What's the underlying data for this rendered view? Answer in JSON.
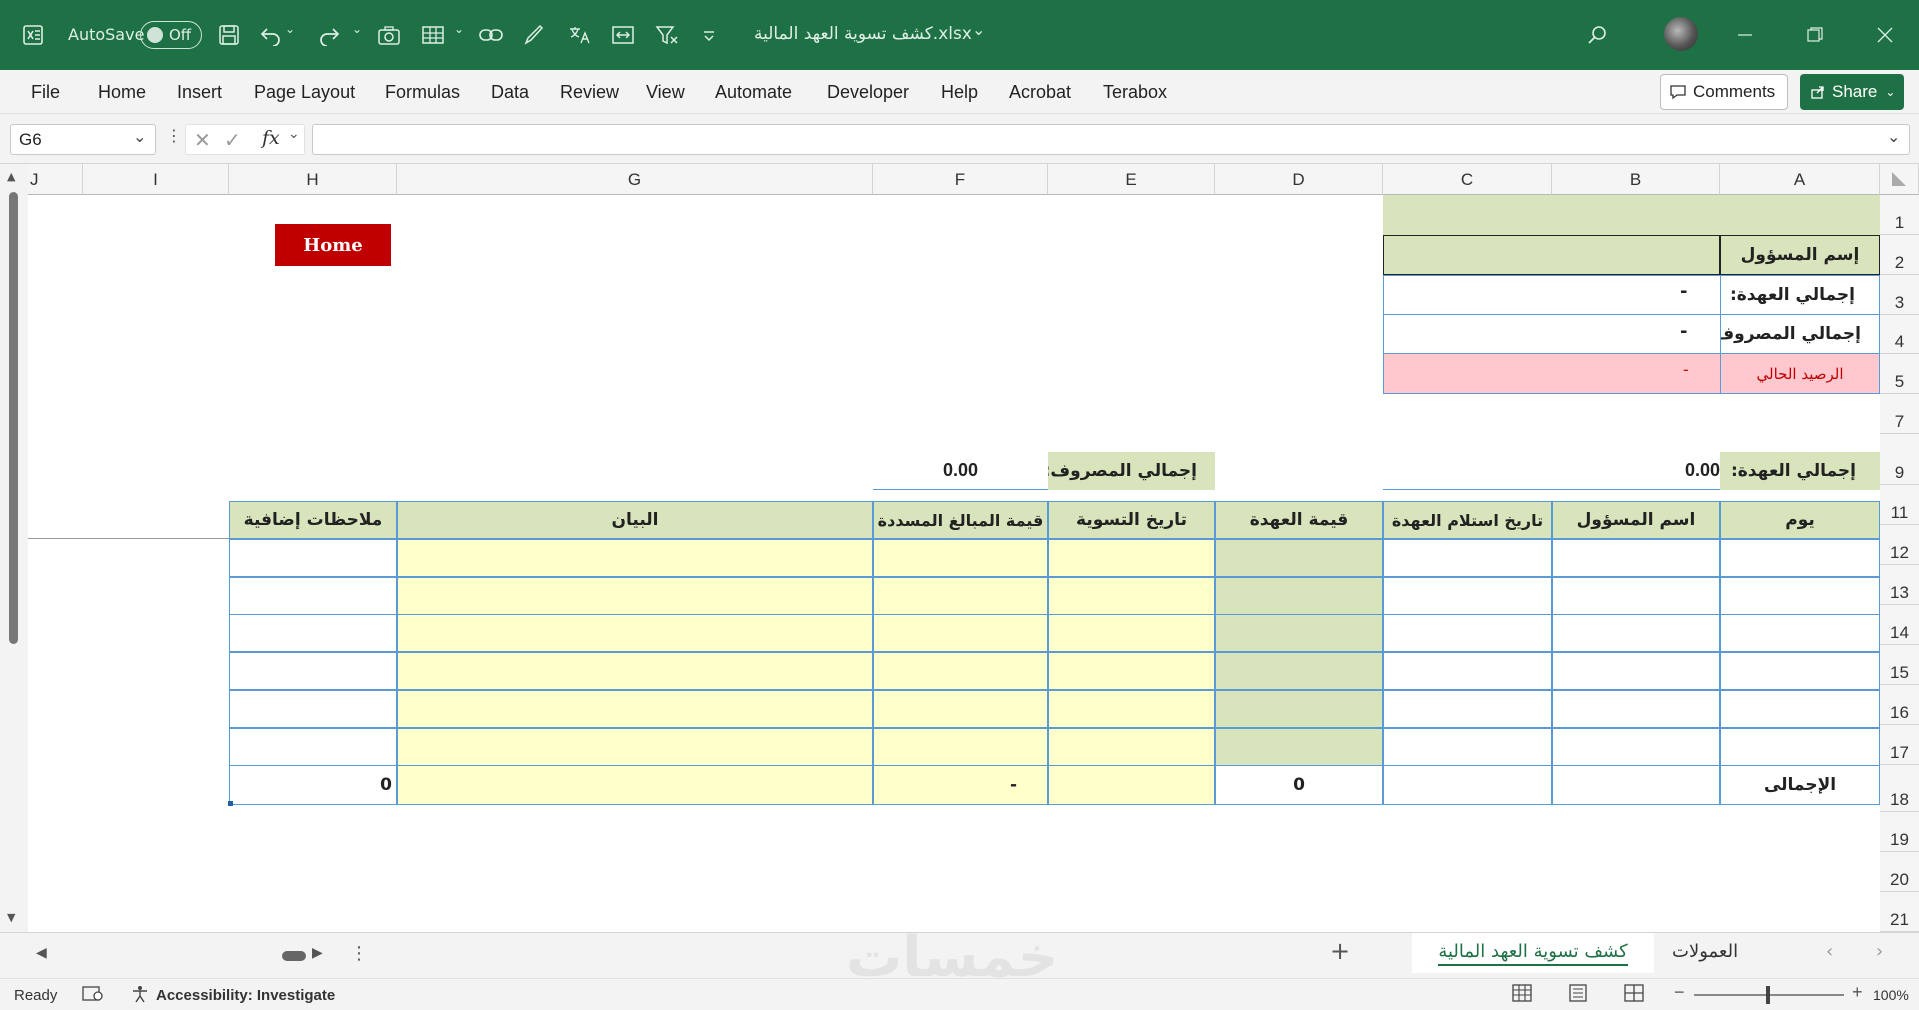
{
  "titlebar": {
    "autosave_label": "AutoSave",
    "autosave_state": "Off",
    "filename": "كشف تسوية العهد المالية.xlsx",
    "icons": [
      "excel-icon",
      "save-icon",
      "undo-icon",
      "redo-icon",
      "camera-icon",
      "table-icon",
      "link-icon",
      "brush-icon",
      "translate-icon",
      "compress-icon",
      "filter-clear-icon",
      "customize-icon",
      "search-icon",
      "avatar",
      "minimize-icon",
      "restore-icon",
      "close-icon"
    ]
  },
  "ribbon": {
    "tabs": [
      "File",
      "Home",
      "Insert",
      "Page Layout",
      "Formulas",
      "Data",
      "Review",
      "View",
      "Automate",
      "Developer",
      "Help",
      "Acrobat",
      "Terabox"
    ],
    "comments_label": "Comments",
    "share_label": "Share"
  },
  "formula_bar": {
    "name_box": "G6",
    "fx": "fx",
    "formula": ""
  },
  "columns": [
    "J",
    "I",
    "H",
    "G",
    "F",
    "E",
    "D",
    "C",
    "B",
    "A"
  ],
  "rows": [
    "1",
    "2",
    "3",
    "4",
    "5",
    "7",
    "9",
    "11",
    "12",
    "13",
    "14",
    "15",
    "16",
    "17",
    "18",
    "19",
    "20",
    "21"
  ],
  "sheet": {
    "home_button": "Home",
    "top_table": {
      "owner_label": "إسم المسؤول",
      "total_custody_label": "إجمالي العهدة:",
      "total_custody_value": "-",
      "total_spent_label": "إجمالي المصروف:",
      "total_spent_value": "-",
      "current_balance_label": "الرصيد الحالي",
      "current_balance_value": "-"
    },
    "summary": {
      "custody_label": "إجمالي العهدة:",
      "custody_value": "0.00",
      "spent_label": "إجمالي المصروف:",
      "spent_value": "0.00"
    },
    "main_table": {
      "headers": {
        "day": "يوم",
        "owner": "اسم المسؤول",
        "received_date": "تاريخ استلام العهدة",
        "custody_value": "قيمة العهدة",
        "settlement_date": "تاريخ التسوية",
        "paid_amount": "قيمة المبالغ المسددة",
        "statement": "البيان",
        "notes": "ملاحظات إضافية"
      },
      "total_label": "الإجمالى",
      "total_custody": "0",
      "total_paid": "-",
      "total_notes": "0"
    }
  },
  "sheet_tabs": {
    "active": "كشف تسوية العهد المالية",
    "other": "العمولات",
    "watermark": "خمسات"
  },
  "status": {
    "ready": "Ready",
    "accessibility": "Accessibility: Investigate",
    "zoom": "100%"
  },
  "colors": {
    "title_green": "#1e7145",
    "header_green": "#d8e4bc",
    "input_yellow": "#ffffcc",
    "balance_pink": "#ffc7ce",
    "home_red": "#c00000"
  }
}
